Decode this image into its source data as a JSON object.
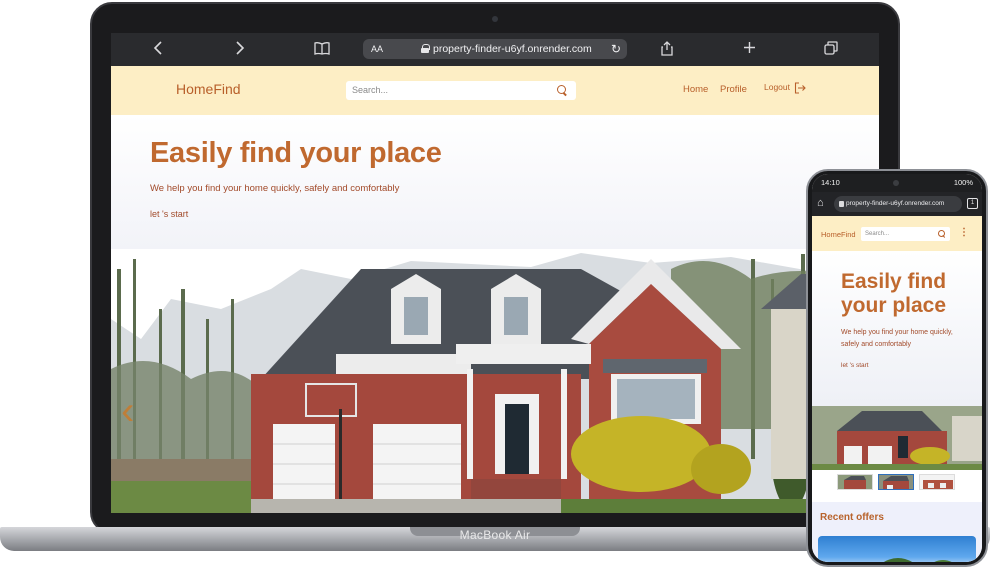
{
  "laptop": {
    "model_label": "MacBook Air",
    "browser": {
      "back_icon": "chevron-left-icon",
      "forward_icon": "chevron-right-icon",
      "bookmarks_icon": "book-icon",
      "text_size_label": "AA",
      "url": "property-finder-u6yf.onrender.com",
      "reload_icon": "reload-icon",
      "share_icon": "share-icon",
      "new_tab_icon": "plus-icon",
      "tabs_icon": "tabs-icon"
    },
    "site": {
      "logo": "HomeFind",
      "search_placeholder": "Search...",
      "nav": {
        "home": "Home",
        "profile": "Profile",
        "logout": "Logout"
      },
      "hero": {
        "title": "Easily find your place",
        "subtitle": "We help you find your home quickly, safely and comfortably",
        "cta": "let 's start"
      },
      "carousel_prev_icon": "chevron-left-icon"
    }
  },
  "phone": {
    "status": {
      "time": "14:10",
      "battery": "100%"
    },
    "url": "property-finder-u6yf.onrender.com",
    "site": {
      "logo": "HomeFind",
      "search_placeholder": "Search...",
      "menu_icon": "kebab-menu-icon",
      "hero": {
        "title": "Easily find your place",
        "subtitle": "We help you find your home quickly, safely and comfortably",
        "cta": "let 's start"
      },
      "thumbnails": 3,
      "active_thumbnail": 2,
      "recent_offers_title": "Recent offers"
    }
  },
  "colors": {
    "header_bg": "#fdeec5",
    "brand": "#c0692f",
    "text_accent": "#a24b2b",
    "browser_chrome": "#2a2b2e"
  }
}
